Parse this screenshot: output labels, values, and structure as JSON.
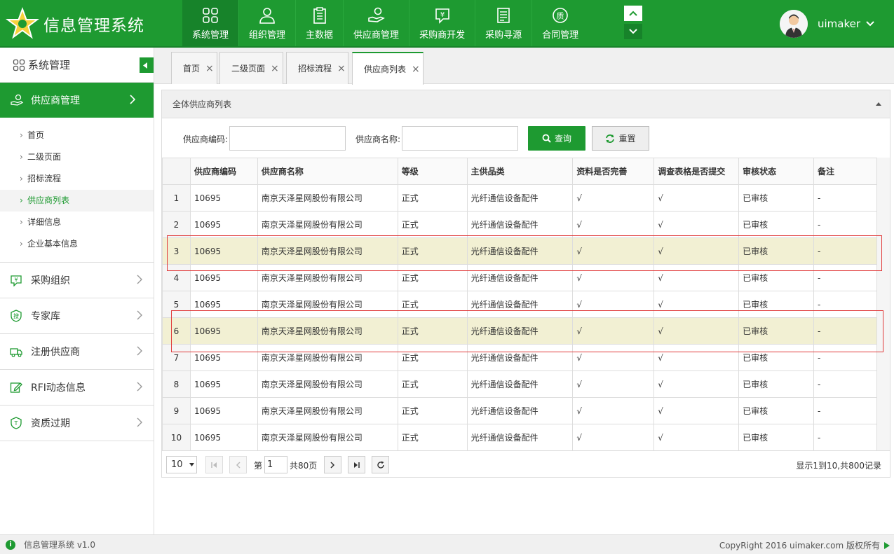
{
  "app": {
    "title": "信息管理系统",
    "username": "uimaker"
  },
  "topnav": [
    {
      "label": "系统管理",
      "icon": "grid-icon",
      "active": true
    },
    {
      "label": "组织管理",
      "icon": "user-icon",
      "active": false
    },
    {
      "label": "主数据",
      "icon": "clipboard-icon",
      "active": false
    },
    {
      "label": "供应商管理",
      "icon": "hand-coin-icon",
      "active": false
    },
    {
      "label": "采购商开发",
      "icon": "yen-chat-icon",
      "active": false
    },
    {
      "label": "采购寻源",
      "icon": "document-icon",
      "active": false
    },
    {
      "label": "合同管理",
      "icon": "quality-badge-icon",
      "active": false
    }
  ],
  "sidebar": {
    "title": "系统管理",
    "active_group": "供应商管理",
    "sub_items": [
      {
        "label": "首页",
        "active": false
      },
      {
        "label": "二级页面",
        "active": false
      },
      {
        "label": "招标流程",
        "active": false
      },
      {
        "label": "供应商列表",
        "active": true
      },
      {
        "label": "详细信息",
        "active": false
      },
      {
        "label": "企业基本信息",
        "active": false
      }
    ],
    "groups": [
      {
        "label": "采购组织",
        "icon": "yen-chat-icon"
      },
      {
        "label": "专家库",
        "icon": "shield-search-icon"
      },
      {
        "label": "注册供应商",
        "icon": "truck-icon"
      },
      {
        "label": "RFI动态信息",
        "icon": "edit-icon"
      },
      {
        "label": "资质过期",
        "icon": "shield-t-icon"
      }
    ]
  },
  "tabs": [
    {
      "label": "首页",
      "close": "×",
      "active": false
    },
    {
      "label": "二级页面",
      "close": "×",
      "active": false
    },
    {
      "label": "招标流程",
      "close": "×",
      "active": false
    },
    {
      "label": "供应商列表",
      "close": "×",
      "active": true
    }
  ],
  "panel": {
    "title": "全体供应商列表"
  },
  "search": {
    "code_label": "供应商编码:",
    "name_label": "供应商名称:",
    "code_value": "",
    "name_value": "",
    "query_label": "查询",
    "reset_label": "重置"
  },
  "table": {
    "columns": [
      "供应商编码",
      "供应商名称",
      "等级",
      "主供品类",
      "资料是否完善",
      "调查表格是否提交",
      "审核状态",
      "备注"
    ],
    "rows": [
      {
        "idx": "1",
        "code": "10695",
        "name": "南京天泽星网股份有限公司",
        "level": "正式",
        "category": "光纤通信设备配件",
        "complete": "√",
        "submitted": "√",
        "status": "已审核",
        "note": "-",
        "highlight": false
      },
      {
        "idx": "2",
        "code": "10695",
        "name": "南京天泽星网股份有限公司",
        "level": "正式",
        "category": "光纤通信设备配件",
        "complete": "√",
        "submitted": "√",
        "status": "已审核",
        "note": "-",
        "highlight": false
      },
      {
        "idx": "3",
        "code": "10695",
        "name": "南京天泽星网股份有限公司",
        "level": "正式",
        "category": "光纤通信设备配件",
        "complete": "√",
        "submitted": "√",
        "status": "已审核",
        "note": "-",
        "highlight": true
      },
      {
        "idx": "4",
        "code": "10695",
        "name": "南京天泽星网股份有限公司",
        "level": "正式",
        "category": "光纤通信设备配件",
        "complete": "√",
        "submitted": "√",
        "status": "已审核",
        "note": "-",
        "highlight": false
      },
      {
        "idx": "5",
        "code": "10695",
        "name": "南京天泽星网股份有限公司",
        "level": "正式",
        "category": "光纤通信设备配件",
        "complete": "√",
        "submitted": "√",
        "status": "已审核",
        "note": "-",
        "highlight": false
      },
      {
        "idx": "6",
        "code": "10695",
        "name": "南京天泽星网股份有限公司",
        "level": "正式",
        "category": "光纤通信设备配件",
        "complete": "√",
        "submitted": "√",
        "status": "已审核",
        "note": "-",
        "highlight": true
      },
      {
        "idx": "7",
        "code": "10695",
        "name": "南京天泽星网股份有限公司",
        "level": "正式",
        "category": "光纤通信设备配件",
        "complete": "√",
        "submitted": "√",
        "status": "已审核",
        "note": "-",
        "highlight": false
      },
      {
        "idx": "8",
        "code": "10695",
        "name": "南京天泽星网股份有限公司",
        "level": "正式",
        "category": "光纤通信设备配件",
        "complete": "√",
        "submitted": "√",
        "status": "已审核",
        "note": "-",
        "highlight": false
      },
      {
        "idx": "9",
        "code": "10695",
        "name": "南京天泽星网股份有限公司",
        "level": "正式",
        "category": "光纤通信设备配件",
        "complete": "√",
        "submitted": "√",
        "status": "已审核",
        "note": "-",
        "highlight": false
      },
      {
        "idx": "10",
        "code": "10695",
        "name": "南京天泽星网股份有限公司",
        "level": "正式",
        "category": "光纤通信设备配件",
        "complete": "√",
        "submitted": "√",
        "status": "已审核",
        "note": "-",
        "highlight": false
      }
    ]
  },
  "pager": {
    "page_size": "10",
    "page_prefix": "第",
    "current_page": "1",
    "total_pages_text": "共80页",
    "summary": "显示1到10,共800记录"
  },
  "footer": {
    "left": "信息管理系统 v1.0",
    "right": "CopyRight 2016  uimaker.com 版权所有"
  },
  "colors": {
    "brand": "#1e9a31",
    "highlight_row": "#f2f0d3",
    "annotation": "#e03a3a"
  }
}
